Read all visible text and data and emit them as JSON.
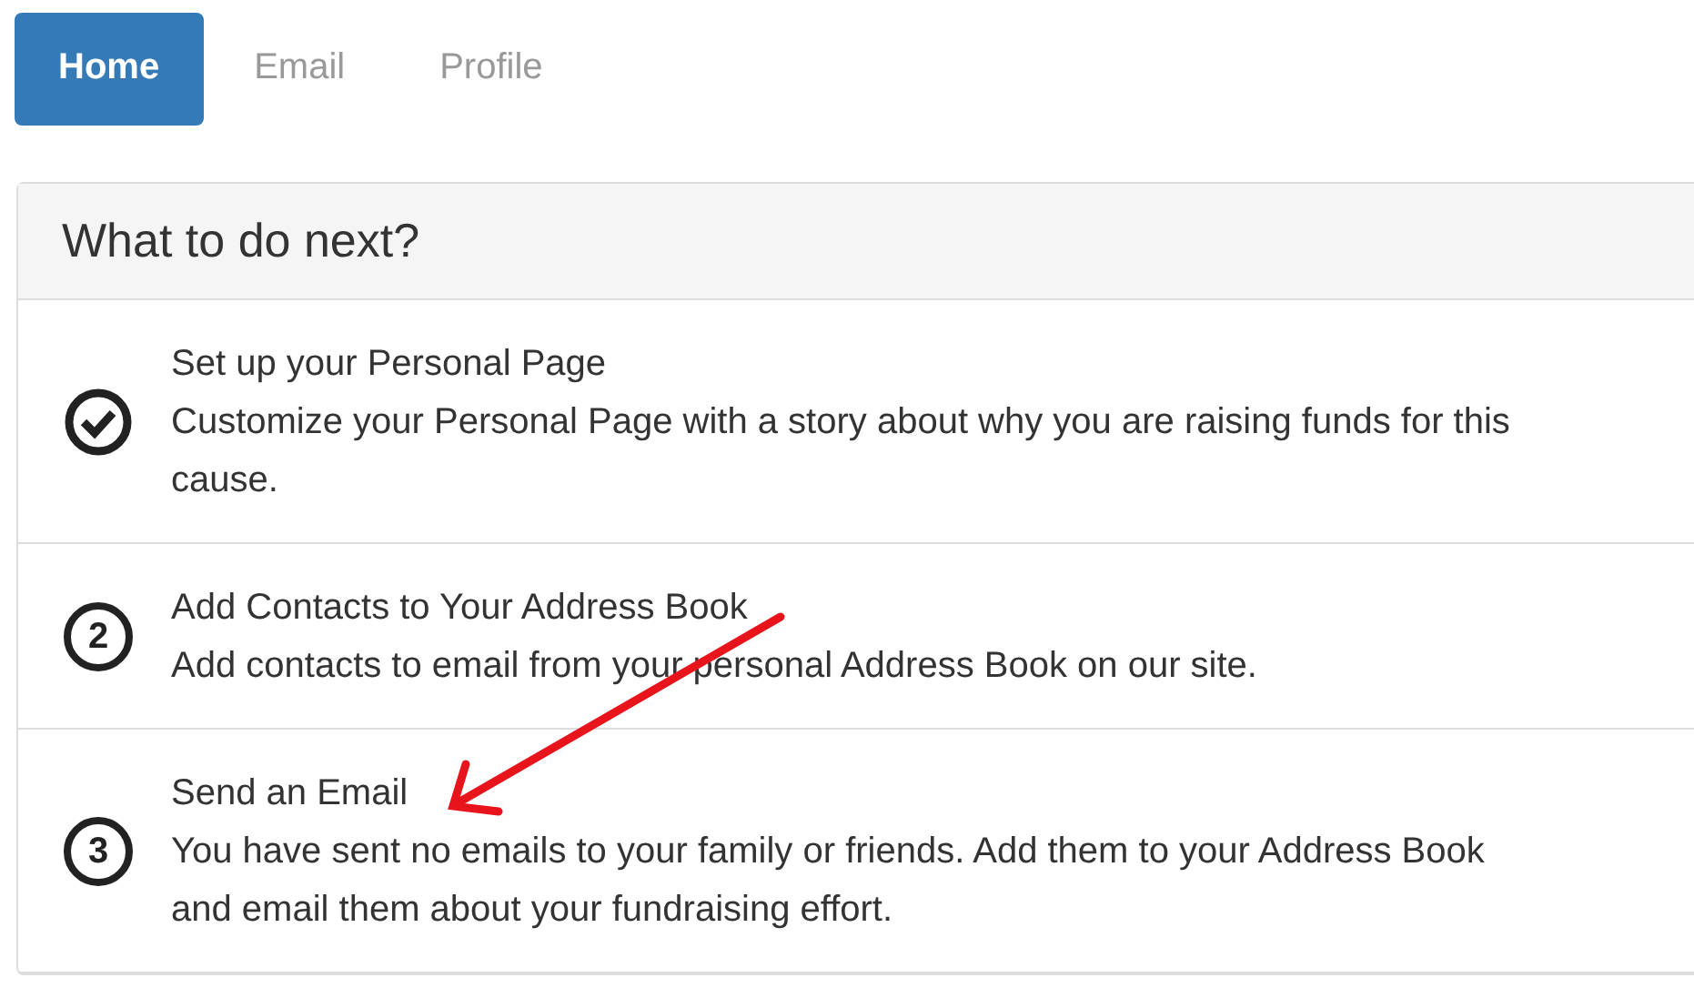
{
  "tabs": [
    {
      "label": "Home",
      "selected": true
    },
    {
      "label": "Email",
      "selected": false
    },
    {
      "label": "Profile",
      "selected": false
    }
  ],
  "panel": {
    "title": "What to do next?",
    "steps": [
      {
        "kind": "done",
        "title": "Set up your Personal Page",
        "description": "Customize your Personal Page with a story about why you are raising funds for this cause."
      },
      {
        "kind": "number",
        "number": "2",
        "title": "Add Contacts to Your Address Book",
        "description": "Add contacts to email from your personal Address Book on our site."
      },
      {
        "kind": "number",
        "number": "3",
        "title": "Send an Email",
        "description": "You have sent no emails to your family or friends. Add them to your Address Book and email them about your fundraising effort."
      }
    ]
  },
  "annotation": {
    "kind": "arrow"
  }
}
